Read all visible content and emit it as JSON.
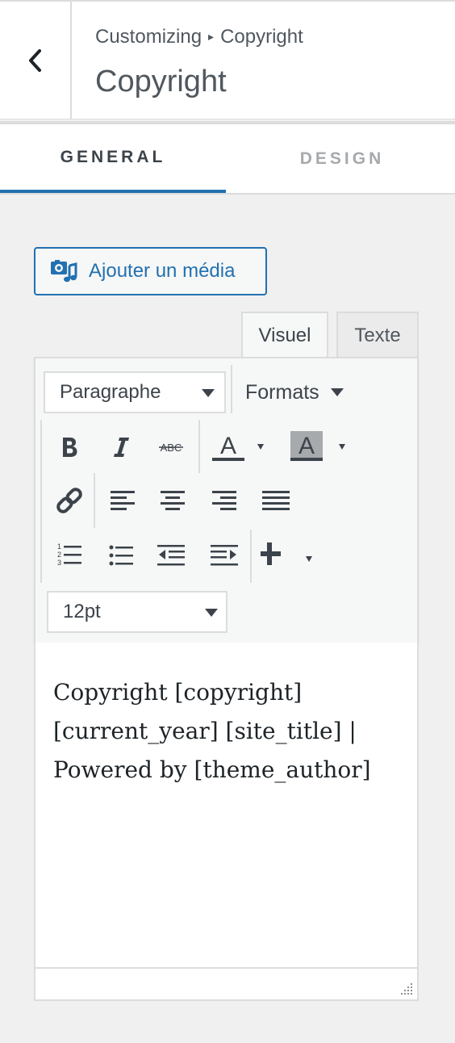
{
  "header": {
    "breadcrumb_parent": "Customizing",
    "breadcrumb_separator": "▸",
    "breadcrumb_current": "Copyright",
    "title": "Copyright"
  },
  "tabs": [
    {
      "label": "GENERAL",
      "active": true
    },
    {
      "label": "DESIGN",
      "active": false
    }
  ],
  "add_media": {
    "label": "Ajouter un média"
  },
  "editor_modes": {
    "visual": "Visuel",
    "text": "Texte"
  },
  "toolbar": {
    "block_format": "Paragraphe",
    "formats_label": "Formats",
    "font_size": "12pt",
    "icons": [
      "bold-icon",
      "italic-icon",
      "strikethrough-icon",
      "text-color-icon",
      "background-color-icon",
      "link-icon",
      "align-left-icon",
      "align-center-icon",
      "align-right-icon",
      "align-justify-icon",
      "numbered-list-icon",
      "bullet-list-icon",
      "outdent-icon",
      "indent-icon",
      "insert-plus-icon"
    ]
  },
  "content": {
    "text": "Copyright [copyright] [current_year] [site_title] | Powered by [theme_author]"
  },
  "colors": {
    "accent": "#2271b1",
    "border": "#dcdcde",
    "background": "#f0f0f1"
  }
}
